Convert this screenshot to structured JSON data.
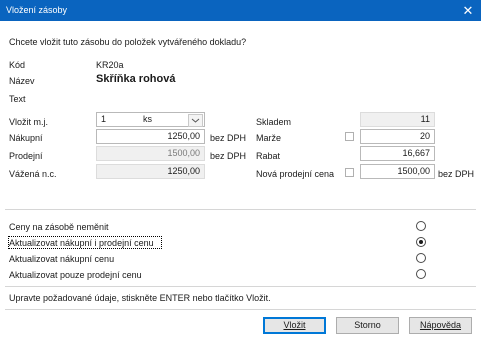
{
  "window": {
    "title": "Vložení zásoby",
    "close_glyph": "✕"
  },
  "prompt": "Chcete vložit tuto zásobu do položek vytvářeného dokladu?",
  "fields": {
    "kod_label": "Kód",
    "kod_value": "KR20a",
    "nazev_label": "Název",
    "nazev_value": "Skříňka rohová",
    "text_label": "Text",
    "vlozit_mj_label": "Vložit m.j.",
    "vlozit_mj_qty": "1",
    "vlozit_mj_unit": "ks",
    "nakupni_label": "Nákupní",
    "nakupni_value": "1250,00",
    "nakupni_suffix": "bez DPH",
    "prodejni_label": "Prodejní",
    "prodejni_value": "1500,00",
    "prodejni_suffix": "bez DPH",
    "vazena_label": "Vážená n.c.",
    "vazena_value": "1250,00",
    "skladem_label": "Skladem",
    "skladem_value": "11",
    "marze_label": "Marže",
    "marze_value": "20",
    "rabat_label": "Rabat",
    "rabat_value": "16,667",
    "nova_label": "Nová prodejní cena",
    "nova_value": "1500,00",
    "nova_suffix": "bez DPH"
  },
  "options": [
    {
      "label": "Ceny na zásobě neměnit",
      "selected": false
    },
    {
      "label": "Aktualizovat nákupní i prodejní cenu",
      "selected": true
    },
    {
      "label": "Aktualizovat nákupní cenu",
      "selected": false
    },
    {
      "label": "Aktualizovat pouze prodejní cenu",
      "selected": false
    }
  ],
  "hint": "Upravte požadované údaje, stiskněte ENTER nebo tlačítko Vložit.",
  "buttons": {
    "insert": "Vložit",
    "cancel": "Storno",
    "help": "Nápověda"
  },
  "colors": {
    "titlebar": "#0a64bf",
    "default_button_border": "#0078d7"
  }
}
